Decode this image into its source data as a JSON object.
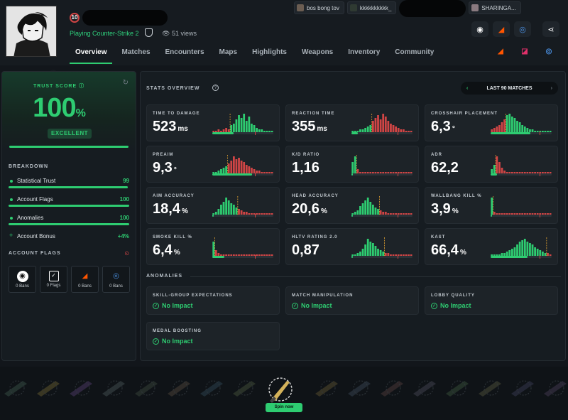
{
  "profile": {
    "level": "10",
    "status": "Playing Counter-Strike 2",
    "views": "51 views"
  },
  "friends": [
    {
      "name": "bos bong tov"
    },
    {
      "name": "kkkkkkkkkk_"
    },
    {
      "name": ""
    },
    {
      "name": "SHARINGA..."
    }
  ],
  "nav": {
    "tabs": [
      "Overview",
      "Matches",
      "Encounters",
      "Maps",
      "Highlights",
      "Weapons",
      "Inventory",
      "Community"
    ],
    "active": "Overview"
  },
  "trust": {
    "label": "TRUST SCORE",
    "value": "100",
    "unit": "%",
    "rating": "EXCELLENT",
    "level": 1.0
  },
  "breakdown": {
    "label": "BREAKDOWN",
    "items": [
      {
        "name": "Statistical Trust",
        "value": "99",
        "fill": 0.99
      },
      {
        "name": "Account Flags",
        "value": "100",
        "fill": 1.0
      },
      {
        "name": "Anomalies",
        "value": "100",
        "fill": 1.0
      },
      {
        "name": "Account Bonus",
        "value": "+4%"
      }
    ]
  },
  "account_flags": {
    "label": "ACCOUNT FLAGS",
    "items": [
      {
        "label": "0 Bans",
        "icon": "steam-icon"
      },
      {
        "label": "0 Flags",
        "icon": "vac-shield-icon"
      },
      {
        "label": "0 Bans",
        "icon": "faceit-icon"
      },
      {
        "label": "0 Bans",
        "icon": "esea-icon"
      }
    ]
  },
  "stats_overview": {
    "label": "STATS OVERVIEW",
    "matches_label": "LAST 90 MATCHES",
    "stats": [
      {
        "label": "TIME TO DAMAGE",
        "value": "523",
        "unit": "ms",
        "meter": 0.35
      },
      {
        "label": "REACTION TIME",
        "value": "355",
        "unit": "ms",
        "meter": 0.1
      },
      {
        "label": "CROSSHAIR PLACEMENT",
        "value": "6,3",
        "unit": "°",
        "meter": 0.65
      },
      {
        "label": "PREAIM",
        "value": "9,3",
        "unit": "°",
        "meter": 0.65
      },
      {
        "label": "K/D RATIO",
        "value": "1,16",
        "unit": "",
        "meter": 0.0
      },
      {
        "label": "ADR",
        "value": "62,2",
        "unit": "",
        "meter": 0.1
      },
      {
        "label": "AIM ACCURACY",
        "value": "18,4",
        "unit": "%",
        "meter": 0.0
      },
      {
        "label": "HEAD ACCURACY",
        "value": "20,6",
        "unit": "%",
        "meter": 0.0
      },
      {
        "label": "WALLBANG KILL %",
        "value": "3,9",
        "unit": "%",
        "meter": 0.0
      },
      {
        "label": "SMOKE KILL %",
        "value": "6,4",
        "unit": "%",
        "meter": 0.2
      },
      {
        "label": "HLTV RATING 2.0",
        "value": "0,87",
        "unit": "",
        "meter": 0.0
      },
      {
        "label": "KAST",
        "value": "66,4",
        "unit": "%",
        "meter": 0.6
      }
    ]
  },
  "anomalies": {
    "label": "ANOMALIES",
    "items": [
      {
        "title": "SKILL-GROUP EXPECTATIONS",
        "value": "No Impact"
      },
      {
        "title": "MATCH MANIPULATION",
        "value": "No Impact"
      },
      {
        "title": "LOBBY QUALITY",
        "value": "No Impact"
      },
      {
        "title": "MEDAL BOOSTING",
        "value": "No Impact"
      }
    ]
  },
  "case_banner": {
    "button": "Spin now"
  },
  "colors": {
    "accent": "#2ecc71",
    "danger": "#d04545",
    "warn": "#e0a030",
    "panel": "#161c21"
  }
}
